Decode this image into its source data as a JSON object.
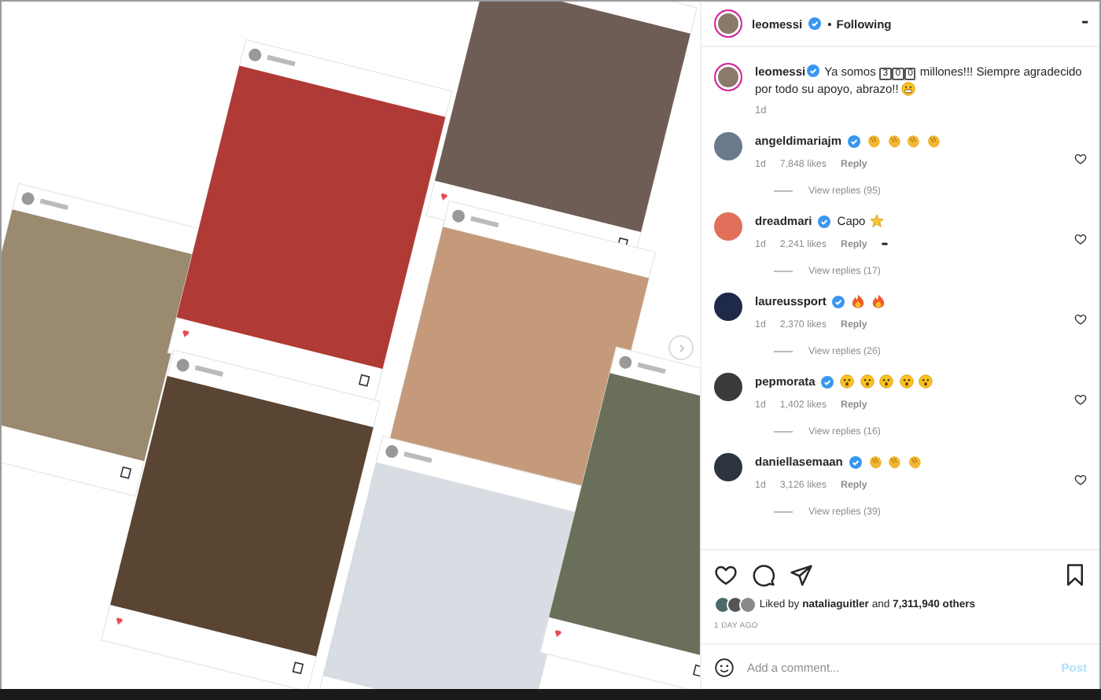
{
  "post": {
    "username": "leomessi",
    "verified": true,
    "separator": "•",
    "follow_label": "Following",
    "more": "•••"
  },
  "caption": {
    "username": "leomessi",
    "verified": true,
    "text_before": "Ya somos",
    "keycaps": [
      "3",
      "0",
      "0"
    ],
    "text_after": "millones!!! Siempre agradecido por todo su apoyo, abrazo!!",
    "emoji": {
      "kind": "grin"
    },
    "time": "1d"
  },
  "comments": [
    {
      "username": "angeldimariajm",
      "verified": true,
      "emojis": [
        {
          "kind": "clap"
        },
        {
          "kind": "clap"
        },
        {
          "kind": "clap"
        },
        {
          "kind": "clap"
        }
      ],
      "time": "1d",
      "likes": "7,848 likes",
      "reply": "Reply",
      "view_replies": "View replies (95)",
      "color": "#6b7a8a"
    },
    {
      "username": "dreadmari",
      "verified": true,
      "text": "Capo",
      "emojis": [
        {
          "kind": "star"
        }
      ],
      "time": "1d",
      "likes": "2,241 likes",
      "reply": "Reply",
      "more": "•••",
      "view_replies": "View replies (17)",
      "color": "#e0705a"
    },
    {
      "username": "laureussport",
      "verified": true,
      "emojis": [
        {
          "kind": "fire"
        },
        {
          "kind": "fire"
        }
      ],
      "time": "1d",
      "likes": "2,370 likes",
      "reply": "Reply",
      "view_replies": "View replies (26)",
      "color": "#1e2a48"
    },
    {
      "username": "pepmorata",
      "verified": true,
      "emojis": [
        {
          "kind": "wow"
        },
        {
          "kind": "wow"
        },
        {
          "kind": "wow"
        },
        {
          "kind": "wow"
        },
        {
          "kind": "wow"
        }
      ],
      "time": "1d",
      "likes": "1,402 likes",
      "reply": "Reply",
      "view_replies": "View replies (16)",
      "color": "#3a3a3a"
    },
    {
      "username": "daniellasemaan",
      "verified": true,
      "emojis": [
        {
          "kind": "clap"
        },
        {
          "kind": "clap"
        },
        {
          "kind": "clap"
        }
      ],
      "time": "1d",
      "likes": "3,126 likes",
      "reply": "Reply",
      "view_replies": "View replies (39)",
      "color": "#2c3440"
    }
  ],
  "liked_by": {
    "prefix": "Liked by",
    "user": "nataliaguitler",
    "middle": "and",
    "count": "7,311,940 others"
  },
  "date": "1 DAY AGO",
  "comment_box": {
    "placeholder": "Add a comment...",
    "post_label": "Post",
    "disabled": true
  }
}
